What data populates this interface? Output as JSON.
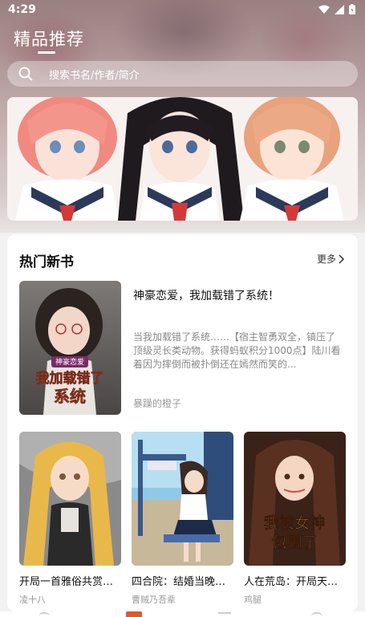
{
  "status": {
    "time": "4:29"
  },
  "header": {
    "title": "精品推荐"
  },
  "search": {
    "placeholder": "搜索书名/作者/简介"
  },
  "section": {
    "title": "热门新书",
    "more": "更多"
  },
  "featured": {
    "title": "神豪恋爱，我加载错了系统！",
    "description": "当我加载错了系统……【宿主智勇双全，镇压了顶级灵长类动物。获得蚂蚁积分1000点】陆川看着因为摔倒而被扑倒还在嫣然而笑的...",
    "author": "暴躁的橙子",
    "cover_lines": [
      "神豪恋爱",
      "我加载错了",
      "系统"
    ]
  },
  "books": [
    {
      "title": "开局一首雅俗共赏…",
      "author": "凌十八"
    },
    {
      "title": "四合院：结婚当晚…",
      "author": "曹贼乃吾辈"
    },
    {
      "title": "人在荒岛：开局天…",
      "author": "鸡腿",
      "cover_lines": [
        "我被女神",
        "包围了"
      ]
    }
  ],
  "colors": {
    "accent": "#e2572e"
  }
}
